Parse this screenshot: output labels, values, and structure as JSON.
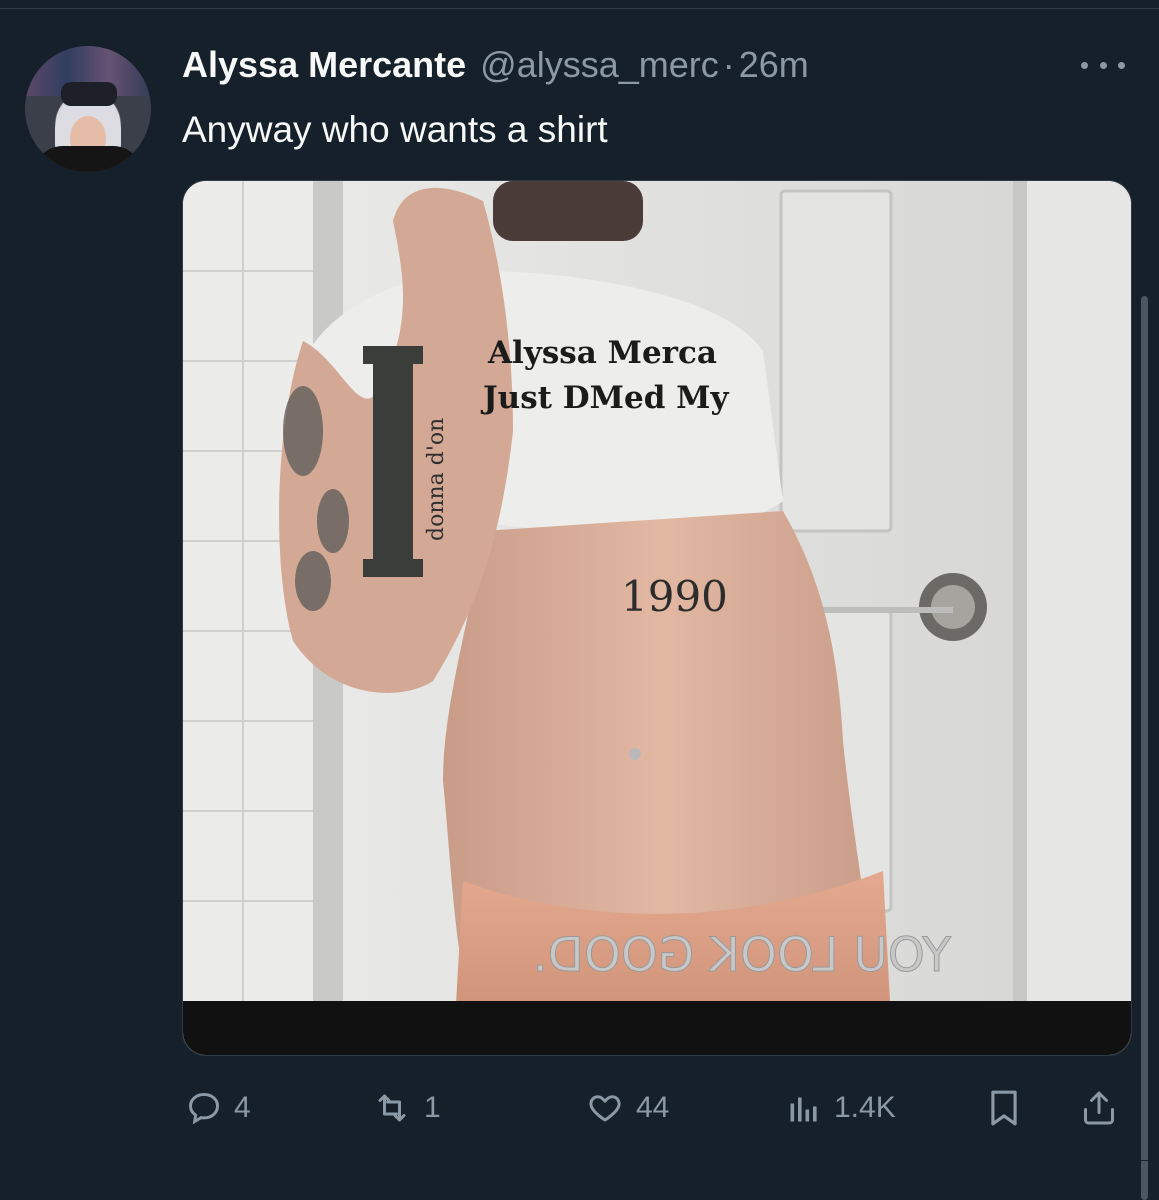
{
  "tweet": {
    "author_name": "Alyssa Mercante",
    "author_handle": "@alyssa_merc",
    "separator": "·",
    "timestamp": "26m",
    "text": "Anyway who wants a shirt",
    "media": {
      "shirt_line1": "Alyssa Merca",
      "shirt_line2": "Just DMed My",
      "tattoo_number": "1990",
      "arm_tattoo": "donna d'on",
      "mirror_sticker": "YOU LOOK GOOD."
    }
  },
  "actions": {
    "reply_count": "4",
    "retweet_count": "1",
    "like_count": "44",
    "view_count": "1.4K"
  },
  "icons": {
    "more": "more-horizontal-icon",
    "reply": "reply-icon",
    "retweet": "retweet-icon",
    "like": "heart-icon",
    "views": "views-chart-icon",
    "bookmark": "bookmark-icon",
    "share": "share-icon"
  },
  "colors": {
    "background": "#15202b",
    "primary_text": "#f7f9f9",
    "secondary_text": "#8b98a5"
  }
}
